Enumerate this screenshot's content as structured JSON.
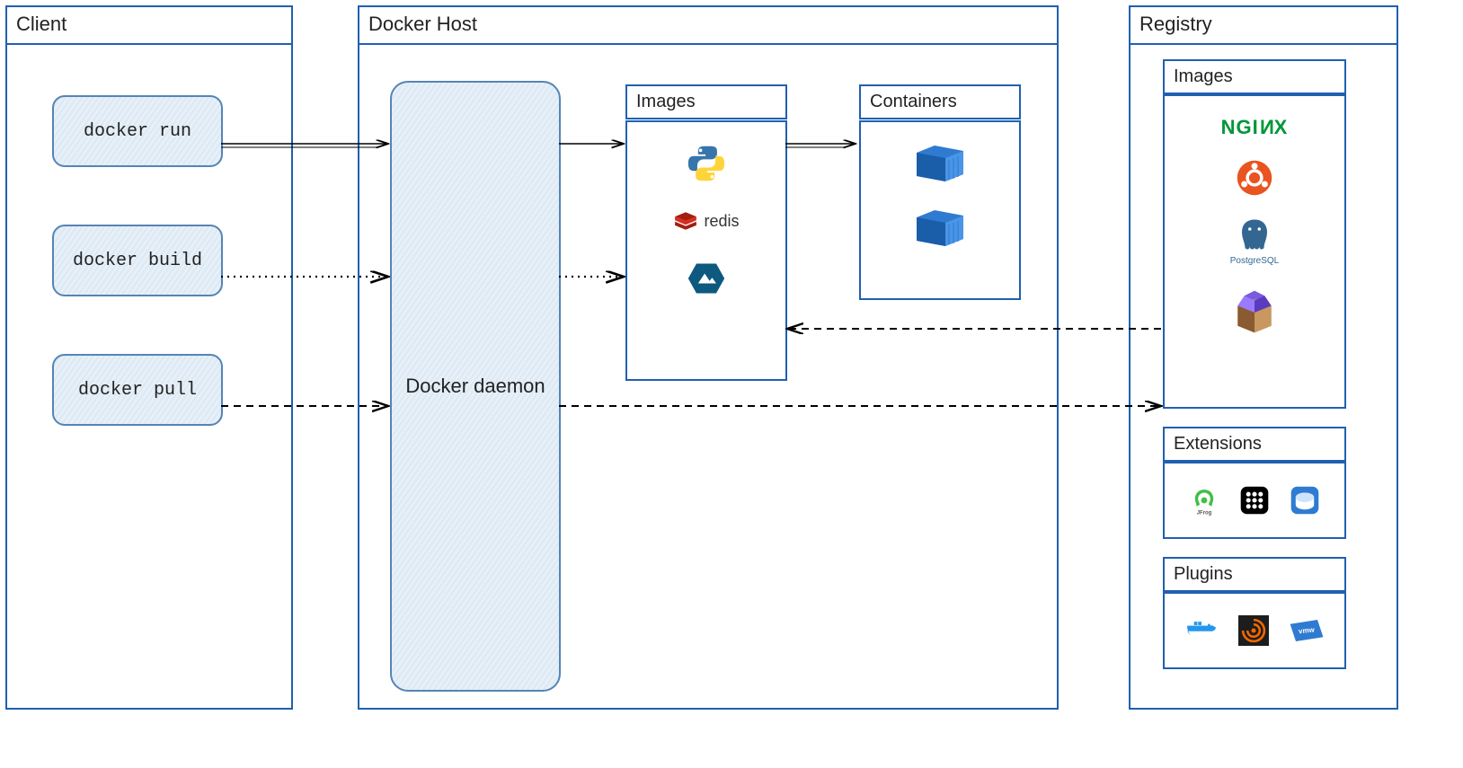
{
  "client": {
    "title": "Client",
    "commands": [
      "docker run",
      "docker build",
      "docker pull"
    ]
  },
  "host": {
    "title": "Docker Host",
    "daemon_label": "Docker daemon",
    "images_label": "Images",
    "containers_label": "Containers",
    "images": [
      "python",
      "redis",
      "alpine"
    ],
    "containers_count": 2
  },
  "registry": {
    "title": "Registry",
    "images_label": "Images",
    "images": [
      "nginx",
      "ubuntu",
      "postgresql",
      "package-box"
    ],
    "extensions_label": "Extensions",
    "extensions": [
      "jfrog",
      "keypad",
      "disk"
    ],
    "plugins_label": "Plugins",
    "plugins": [
      "docker",
      "grafana",
      "vmware"
    ]
  },
  "arrows": [
    {
      "from": "docker-run",
      "to": "daemon",
      "style": "solid"
    },
    {
      "from": "daemon",
      "to": "images",
      "style": "solid"
    },
    {
      "from": "images",
      "to": "containers",
      "style": "solid"
    },
    {
      "from": "docker-build",
      "to": "daemon",
      "style": "dotted"
    },
    {
      "from": "daemon",
      "to": "images",
      "style": "dotted"
    },
    {
      "from": "docker-pull",
      "to": "daemon",
      "style": "dashed"
    },
    {
      "from": "daemon",
      "to": "registry-images",
      "style": "dashed"
    },
    {
      "from": "registry-images",
      "to": "images",
      "style": "dashed"
    }
  ],
  "colors": {
    "border": "#2060b0",
    "fill": "#dce9f3"
  }
}
